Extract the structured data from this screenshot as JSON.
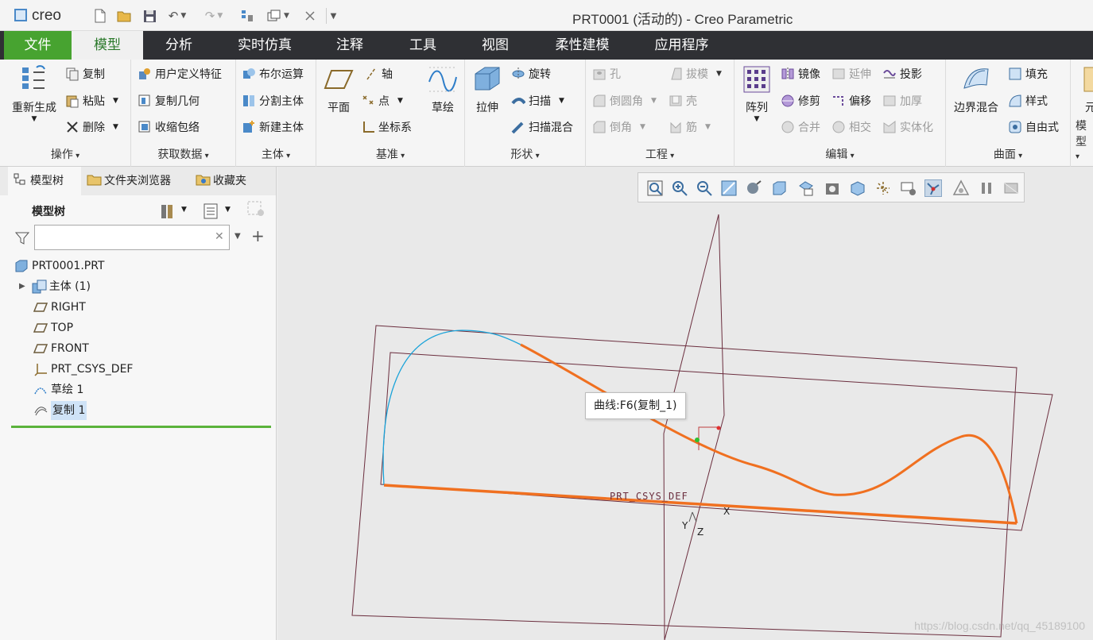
{
  "app": {
    "logo": "creo",
    "window_title": "PRT0001 (活动的) - Creo Parametric"
  },
  "tabs": [
    {
      "label": "文件"
    },
    {
      "label": "模型"
    },
    {
      "label": "分析"
    },
    {
      "label": "实时仿真"
    },
    {
      "label": "注释"
    },
    {
      "label": "工具"
    },
    {
      "label": "视图"
    },
    {
      "label": "柔性建模"
    },
    {
      "label": "应用程序"
    }
  ],
  "ribbon": {
    "ops": {
      "label": "操作",
      "regen": "重新生成",
      "copy": "复制",
      "paste": "粘贴",
      "delete": "删除"
    },
    "getdata": {
      "label": "获取数据",
      "udf": "用户定义特征",
      "copygeom": "复制几何",
      "shrinkwrap": "收缩包络"
    },
    "body": {
      "label": "主体",
      "boolean": "布尔运算",
      "split": "分割主体",
      "newbody": "新建主体"
    },
    "datum": {
      "label": "基准",
      "plane": "平面",
      "axis": "轴",
      "point": "点",
      "csys": "坐标系",
      "sketch": "草绘"
    },
    "shapes": {
      "label": "形状",
      "extrude": "拉伸",
      "revolve": "旋转",
      "sweep": "扫描",
      "swept_blend": "扫描混合"
    },
    "eng": {
      "label": "工程",
      "hole": "孔",
      "round": "倒圆角",
      "chamfer": "倒角",
      "draft": "拔模",
      "shell": "壳",
      "rib": "筋"
    },
    "edit": {
      "label": "编辑",
      "pattern": "阵列",
      "mirror": "镜像",
      "trim": "修剪",
      "merge": "合并",
      "extend": "延伸",
      "offset": "偏移",
      "intersect": "相交",
      "project": "投影",
      "thicken": "加厚",
      "solidify": "实体化"
    },
    "surfaces": {
      "label": "曲面",
      "boundary": "边界混合",
      "fill": "填充",
      "style": "样式",
      "freestyle": "自由式"
    },
    "intent": {
      "label": "模型",
      "top": "元"
    }
  },
  "panel": {
    "tabs": [
      "模型树",
      "文件夹浏览器",
      "收藏夹"
    ],
    "tree_header": "模型树",
    "search_placeholder": "",
    "items": [
      {
        "label": "PRT0001.PRT"
      },
      {
        "label": "主体 (1)"
      },
      {
        "label": "RIGHT"
      },
      {
        "label": "TOP"
      },
      {
        "label": "FRONT"
      },
      {
        "label": "PRT_CSYS_DEF"
      },
      {
        "label": "草绘 1"
      },
      {
        "label": "复制 1"
      }
    ]
  },
  "viewport": {
    "tooltip": "曲线:F6(复制_1)",
    "csys_label": "PRT_CSYS_DEF",
    "axis_x": "X",
    "axis_y": "Y",
    "axis_z": "Z",
    "watermark": "https://blog.csdn.net/qq_45189100"
  },
  "colors": {
    "accent_green": "#47a330",
    "curve_orange": "#f07020",
    "sketch_cyan": "#1aa3d9",
    "datum_plane": "#6b2e3e"
  }
}
